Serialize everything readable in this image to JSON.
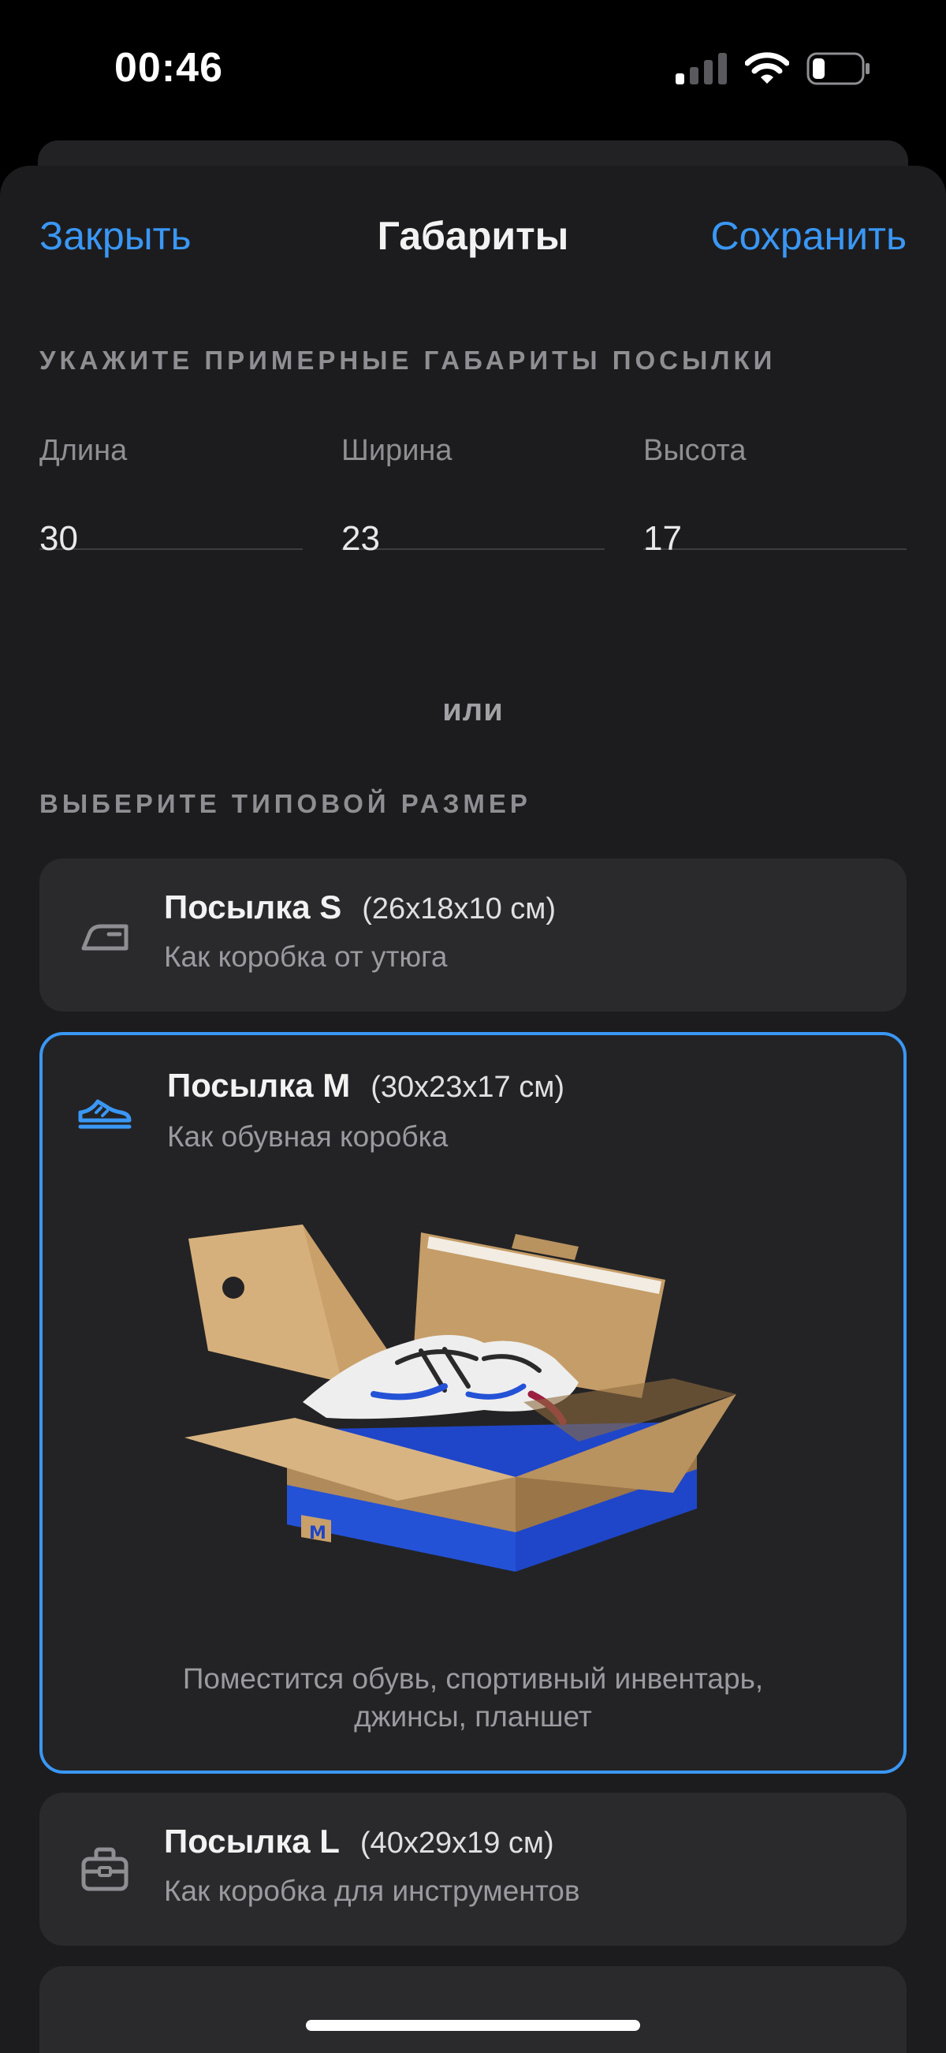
{
  "status_bar": {
    "time": "00:46"
  },
  "nav": {
    "close": "Закрыть",
    "title": "Габариты",
    "save": "Сохранить"
  },
  "dimensions": {
    "section_title": "УКАЖИТЕ ПРИМЕРНЫЕ ГАБАРИТЫ ПОСЫЛКИ",
    "length": {
      "label": "Длина",
      "value": "30"
    },
    "width": {
      "label": "Ширина",
      "value": "23"
    },
    "height": {
      "label": "Высота",
      "value": "17"
    }
  },
  "or_text": "или",
  "sizes": {
    "section_title": "ВЫБЕРИТЕ ТИПОВОЙ РАЗМЕР",
    "items": [
      {
        "title": "Посылка S",
        "size": "(26x18x10 см)",
        "subtitle": "Как коробка от утюга",
        "icon": "iron-icon",
        "selected": false
      },
      {
        "title": "Посылка M",
        "size": "(30x23x17 см)",
        "subtitle": "Как обувная коробка",
        "icon": "sneaker-icon",
        "selected": true,
        "box_label": "M",
        "note_line1": "Поместится обувь, спортивный инвентарь,",
        "note_line2": "джинсы, планшет"
      },
      {
        "title": "Посылка L",
        "size": "(40x29x19 см)",
        "subtitle": "Как коробка для инструментов",
        "icon": "toolbox-icon",
        "selected": false
      }
    ]
  },
  "colors": {
    "accent": "#3a97f5",
    "background": "#1c1c1e",
    "card": "#2a2a2c"
  }
}
